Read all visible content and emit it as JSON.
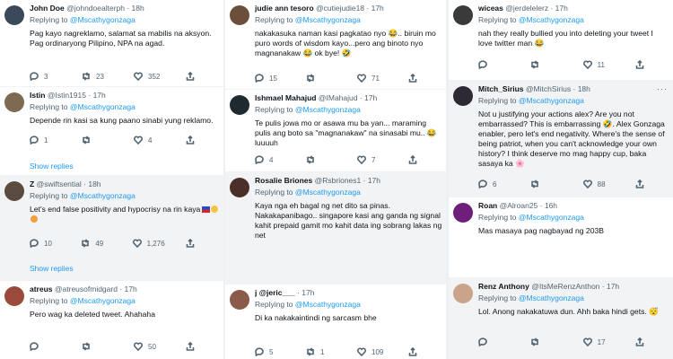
{
  "columns": [
    {
      "tweets": [
        {
          "name": "John Doe",
          "handle": "@johndoealterph",
          "time": "· 18h",
          "replying_to": "Replying to",
          "mention": "@Mscathygonzaga",
          "text": "Pag kayo nagreklamo, salamat sa mabilis na aksyon. Pag ordinaryong Pilipino, NPA na agad.",
          "replies": "3",
          "retweets": "23",
          "likes": "352",
          "avatar_color": "#3a4a5a"
        },
        {
          "name": "Istin",
          "handle": "@Istin1915",
          "time": "· 17h",
          "replying_to": "Replying to",
          "mention": "@Mscathygonzaga",
          "text": "Depende rin kasi sa kung paano sinabi yung reklamo.",
          "replies": "1",
          "retweets": "",
          "likes": "4",
          "avatar_color": "#7d6a50",
          "show_replies": "Show replies"
        },
        {
          "name": "Z",
          "handle": "@swiftsential",
          "time": "· 18h",
          "replying_to": "Replying to",
          "mention": "@Mscathygonzaga",
          "text": "Let's end false positivity and hypocrisy na rin kaya",
          "replies": "10",
          "retweets": "49",
          "likes": "1,276",
          "avatar_color": "#5b4a3f",
          "show_replies": "Show replies"
        },
        {
          "name": "atreus",
          "handle": "@atreusofmidgard",
          "time": "· 17h",
          "replying_to": "Replying to",
          "mention": "@Mscathygonzaga",
          "text": "Pero wag ka deleted tweet. Ahahaha",
          "replies": "",
          "retweets": "",
          "likes": "50",
          "avatar_color": "#9a4a3a"
        }
      ]
    },
    {
      "tweets": [
        {
          "name": "judie ann tesoro",
          "handle": "@cutiejudie18",
          "time": "· 17h",
          "replying_to": "Replying to",
          "mention": "@Mscathygonzaga",
          "text": "nakakasuka naman kasi pagkatao nyo 😂.. biruin mo puro words of wisdom kayo...pero ang binoto nyo magnanakaw 😂 ok bye! 🤣",
          "replies": "15",
          "retweets": "",
          "likes": "71",
          "avatar_color": "#6b4f3a"
        },
        {
          "name": "Ishmael Mahajud",
          "handle": "@IMahajud",
          "time": "· 17h",
          "replying_to": "Replying to",
          "mention": "@Mscathygonzaga",
          "text": "Te pulis jowa mo or asawa mu ba yan... maraming pulis ang boto sa \"magnanakaw\" na sinasabi mu.. 😂 luuuuh",
          "replies": "4",
          "retweets": "",
          "likes": "7",
          "avatar_color": "#1f2a30"
        },
        {
          "name": "Rosalie Briones",
          "handle": "@Rsbriones1",
          "time": "· 17h",
          "replying_to": "Replying to",
          "mention": "@Mscathygonzaga",
          "text": "Kaya nga eh bagal ng net dito sa pinas. Nakakapanibago.. singapore kasi ang ganda ng signal kahit prepaid gamit mo kahit data ing sobrang lakas ng net",
          "replies": "",
          "retweets": "",
          "likes": "",
          "avatar_color": "#4a3028"
        },
        {
          "name": "j @jeric___",
          "handle": "",
          "time": "· 17h",
          "replying_to": "Replying to",
          "mention": "@Mscathygonzaga",
          "text": "Di ka nakakaintindi ng sarcasm bhe",
          "replies": "5",
          "retweets": "1",
          "likes": "109",
          "avatar_color": "#8a5a4a"
        }
      ]
    },
    {
      "tweets": [
        {
          "name": "wiceas",
          "handle": "@jerdelelerz",
          "time": "· 17h",
          "replying_to": "Replying to",
          "mention": "@Mscathygonzaga",
          "text": "nah they really bullied you into deleting your tweet I love twitter man 😂",
          "replies": "",
          "retweets": "",
          "likes": "11",
          "avatar_color": "#3a3a3a"
        },
        {
          "name": "Mitch_Sirius",
          "handle": "@MitchSirius",
          "time": "· 18h",
          "replying_to": "Replying to",
          "mention": "@Mscathygonzaga",
          "text": "Not u justifying your actions alex? Are you not embarrassed? This is embarrassing 🤣. Alex Gonzaga enabler, pero let's end negativity. Where's the sense of being patriot, when you can't acknowledge your own history? I think deserve mo mag happy cup, baka sasaya ka 🌸",
          "replies": "6",
          "retweets": "",
          "likes": "88",
          "avatar_color": "#2e2a35"
        },
        {
          "name": "Roan",
          "handle": "@Alroan25",
          "time": "· 16h",
          "replying_to": "Replying to",
          "mention": "@Mscathygonzaga",
          "text": "Mas masaya pag nagbayad ng 203B",
          "replies": "",
          "retweets": "",
          "likes": "",
          "avatar_color": "#6e1f7a"
        },
        {
          "name": "Renz Anthony",
          "handle": "@ItsMeRenzAnthon",
          "time": "· 17h",
          "replying_to": "Replying to",
          "mention": "@Mscathygonzaga",
          "text": "Lol. Anong nakakatuwa dun. Ahh baka hindi gets. 😴",
          "replies": "",
          "retweets": "",
          "likes": "17",
          "avatar_color": "#c9a48a"
        }
      ]
    }
  ]
}
